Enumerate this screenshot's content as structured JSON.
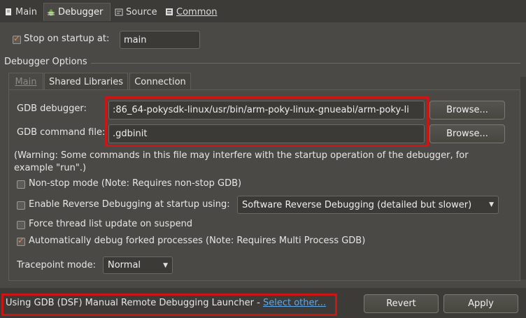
{
  "top_tabs": [
    {
      "label": "Main",
      "icon": "page-icon"
    },
    {
      "label": "Debugger",
      "icon": "bug-icon"
    },
    {
      "label": "Source",
      "icon": "source-icon"
    },
    {
      "label": "Common",
      "icon": "common-icon"
    }
  ],
  "stop_on_startup": {
    "label": "Stop on startup at:",
    "checked": true,
    "value": "main"
  },
  "debugger_options": {
    "title": "Debugger Options",
    "tabs": [
      {
        "label": "Main"
      },
      {
        "label": "Shared Libraries"
      },
      {
        "label": "Connection"
      }
    ],
    "gdb_debugger": {
      "label": "GDB debugger:",
      "value": ":86_64-pokysdk-linux/usr/bin/arm-poky-linux-gnueabi/arm-poky-li",
      "browse": "Browse..."
    },
    "gdb_command_file": {
      "label": "GDB command file:",
      "value": ".gdbinit",
      "browse": "Browse..."
    },
    "warning_line1": "(Warning: Some commands in this file may interfere with the startup operation of the debugger, for",
    "warning_line2": "example \"run\".)",
    "non_stop": {
      "label": "Non-stop mode (Note: Requires non-stop GDB)",
      "checked": false
    },
    "reverse": {
      "label": "Enable Reverse Debugging at startup using:",
      "checked": false,
      "option": "Software Reverse Debugging (detailed but slower)"
    },
    "force_thread": {
      "label": "Force thread list update on suspend",
      "checked": false
    },
    "auto_forked": {
      "label": "Automatically debug forked processes (Note: Requires Multi Process GDB)",
      "checked": true
    },
    "tracepoint": {
      "label": "Tracepoint mode:",
      "value": "Normal"
    }
  },
  "footer": {
    "launcher_text": "Using GDB (DSF) Manual Remote Debugging Launcher - ",
    "select_other": "Select other...",
    "revert": "Revert",
    "apply": "Apply"
  },
  "colors": {
    "highlight": "#cc1616",
    "link": "#5fa8e8",
    "check": "#ff7a50"
  }
}
